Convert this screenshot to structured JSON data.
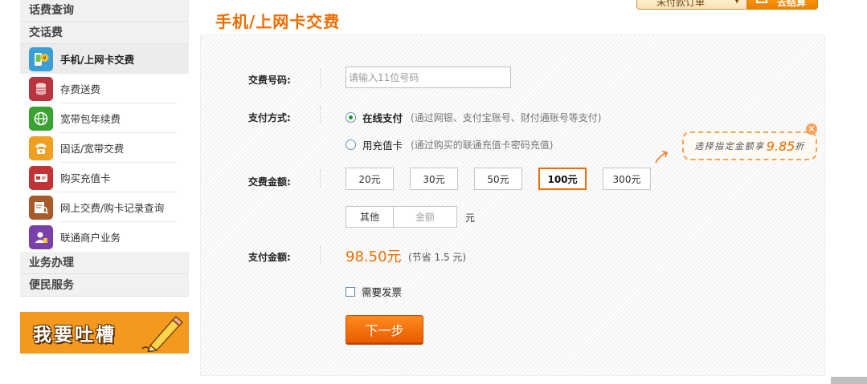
{
  "topbar": {
    "orders_label": "未付款订单",
    "cart_label": "去结算"
  },
  "sidebar": {
    "sections": {
      "query": "话费查询",
      "recharge": "交话费",
      "business": "业务办理",
      "convenience": "便民服务"
    },
    "items": [
      {
        "label": "手机/上网卡交费",
        "icon": "mobile-yuan-icon",
        "color": "#3a9fd6"
      },
      {
        "label": "存费送费",
        "icon": "coin-stack-icon",
        "color": "#b8343f"
      },
      {
        "label": "宽带包年续费",
        "icon": "globe-icon",
        "color": "#3aa232"
      },
      {
        "label": "固话/宽带交费",
        "icon": "telephone-icon",
        "color": "#f0a020"
      },
      {
        "label": "购买充值卡",
        "icon": "card-icon",
        "color": "#c23333"
      },
      {
        "label": "网上交费/购卡记录查询",
        "icon": "record-search-icon",
        "color": "#a85a2a"
      },
      {
        "label": "联通商户业务",
        "icon": "merchant-icon",
        "color": "#7a3fa8"
      }
    ],
    "banner_text": "我要吐槽"
  },
  "main": {
    "title": "手机/上网卡交费",
    "phone_label": "交费号码:",
    "phone_placeholder": "请输入11位号码",
    "payment_label": "支付方式:",
    "payment_options": [
      {
        "name": "在线支付",
        "note": "(通过网银、支付宝账号、财付通账号等支付)",
        "selected": true
      },
      {
        "name": "用充值卡",
        "note": "(通过购买的联通充值卡密码充值)",
        "selected": false
      }
    ],
    "amount_label": "交费金额:",
    "amounts": [
      "20元",
      "30元",
      "50元",
      "100元",
      "300元"
    ],
    "selected_amount": "100元",
    "other_label": "其他",
    "other_placeholder": "金额",
    "other_unit": "元",
    "pay_label": "支付金额:",
    "pay_amount": "98.50元",
    "save_note": "(节省 1.5 元)",
    "invoice_label": "需要发票",
    "next_label": "下一步",
    "promo_text": "选择指定金额享",
    "promo_discount": "9.85",
    "promo_suffix": "折",
    "accent_color": "#f06d00"
  }
}
